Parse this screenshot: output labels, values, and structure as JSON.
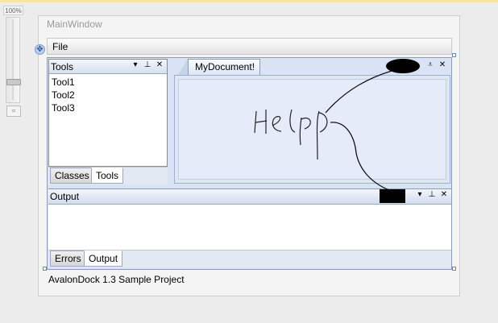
{
  "zoom": {
    "label": "100%",
    "level_percent": 100
  },
  "window": {
    "title": "MainWindow"
  },
  "menu": {
    "file": "File"
  },
  "tools_pane": {
    "title": "Tools",
    "items": [
      "Tool1",
      "Tool2",
      "Tool3"
    ],
    "tabs": [
      "Classes",
      "Tools"
    ],
    "active_tab": "Tools"
  },
  "document": {
    "tab_label": "MyDocument!"
  },
  "output_pane": {
    "title": "Output",
    "tabs": [
      "Errors",
      "Output"
    ],
    "active_tab": "Output"
  },
  "status": {
    "text": "AvalonDock 1.3 Sample Project"
  },
  "pane_buttons": {
    "dropdown": "▾",
    "pin": "⊥",
    "close": "✕"
  },
  "colors": {
    "accent": "#7e9cc9",
    "dock_background": "#d9e3f3",
    "pane_header": "#d5e0f0",
    "ink": "#000000"
  },
  "icons": [
    "move-handle-icon",
    "dropdown-icon",
    "pin-icon",
    "close-icon",
    "zoom-fit-icon"
  ]
}
